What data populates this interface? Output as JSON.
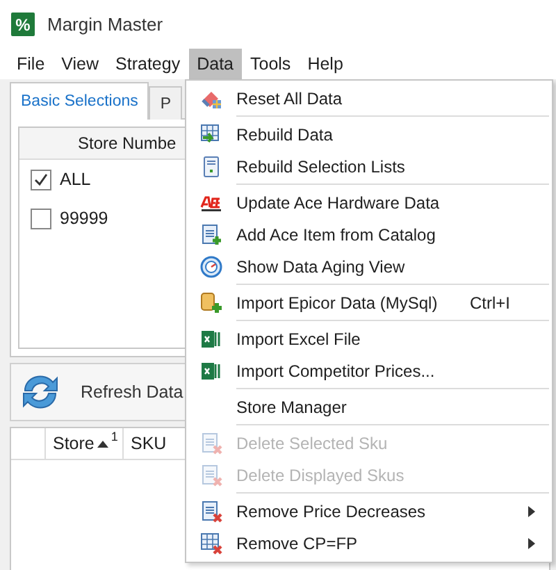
{
  "window": {
    "title": "Margin Master",
    "app_icon_text": "%"
  },
  "menu_bar": [
    {
      "label": "File",
      "selected": false
    },
    {
      "label": "View",
      "selected": false
    },
    {
      "label": "Strategy",
      "selected": false
    },
    {
      "label": "Data",
      "selected": true
    },
    {
      "label": "Tools",
      "selected": false
    },
    {
      "label": "Help",
      "selected": false
    }
  ],
  "tabs": [
    {
      "label": "Basic Selections",
      "selected": true
    },
    {
      "label": "P",
      "selected": false
    }
  ],
  "store_grid": {
    "header": "Store Numbe",
    "rows": [
      {
        "label": "ALL",
        "checked": true
      },
      {
        "label": "99999",
        "checked": false
      }
    ]
  },
  "refresh_button": {
    "label": "Refresh Data"
  },
  "sku_grid": {
    "columns": [
      {
        "label": "Store",
        "sort_ascending": true,
        "sort_index": "1"
      },
      {
        "label": "SKU"
      }
    ]
  },
  "data_menu": [
    [
      {
        "label": "Reset All Data",
        "disabled": false
      }
    ],
    [
      {
        "label": "Rebuild Data",
        "disabled": false
      },
      {
        "label": "Rebuild Selection Lists",
        "disabled": false
      }
    ],
    [
      {
        "label": "Update Ace Hardware Data",
        "disabled": false
      },
      {
        "label": "Add Ace Item from Catalog",
        "disabled": false
      },
      {
        "label": "Show Data Aging View",
        "disabled": false
      }
    ],
    [
      {
        "label": "Import Epicor Data (MySql)",
        "shortcut": "Ctrl+I",
        "disabled": false
      }
    ],
    [
      {
        "label": "Import Excel File",
        "disabled": false
      },
      {
        "label": "Import Competitor Prices...",
        "disabled": false
      }
    ],
    [
      {
        "label": "Store Manager",
        "disabled": false
      }
    ],
    [
      {
        "label": "Delete Selected Sku",
        "disabled": true
      },
      {
        "label": "Delete Displayed Skus",
        "disabled": true
      }
    ],
    [
      {
        "label": "Remove Price Decreases",
        "disabled": false,
        "submenu": true
      },
      {
        "label": "Remove CP=FP",
        "disabled": false,
        "submenu": true
      }
    ]
  ]
}
